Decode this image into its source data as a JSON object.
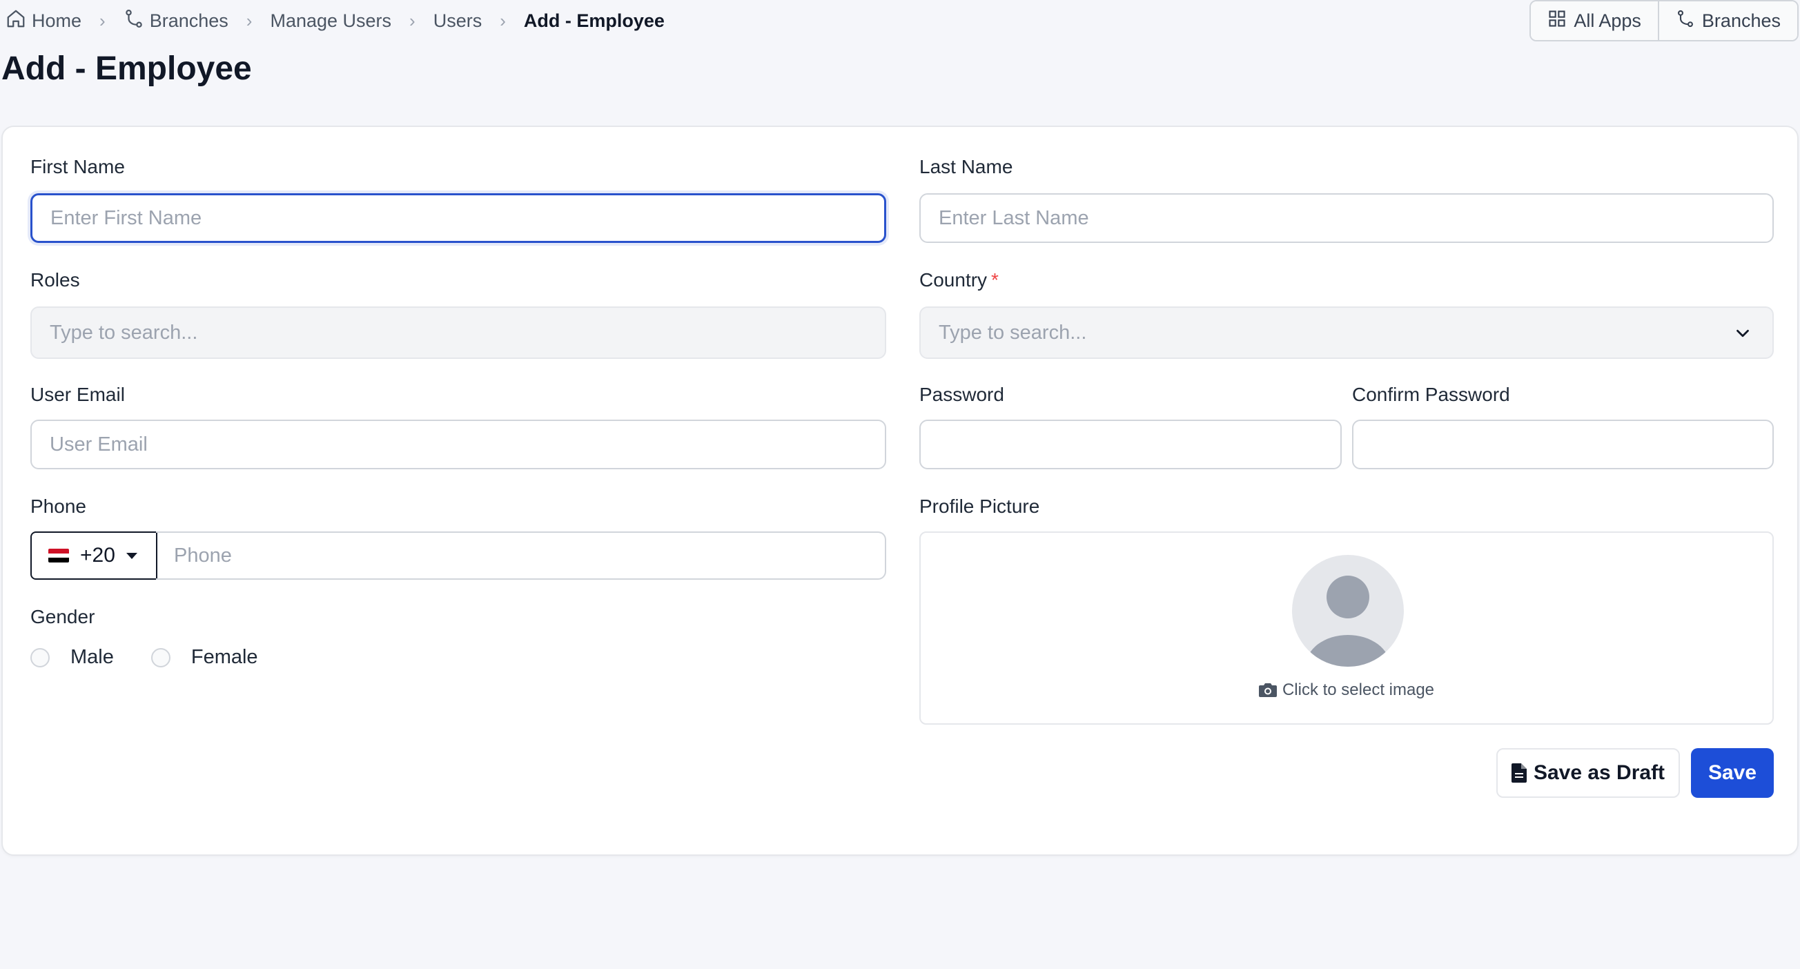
{
  "breadcrumb": {
    "items": [
      "Home",
      "Branches",
      "Manage Users",
      "Users"
    ],
    "current": "Add - Employee"
  },
  "top_actions": {
    "all_apps": "All Apps",
    "branches": "Branches"
  },
  "page_title": "Add - Employee",
  "form": {
    "first_name": {
      "label": "First Name",
      "placeholder": "Enter First Name"
    },
    "last_name": {
      "label": "Last Name",
      "placeholder": "Enter Last Name"
    },
    "roles": {
      "label": "Roles",
      "placeholder": "Type to search..."
    },
    "country": {
      "label": "Country",
      "required_mark": "*",
      "placeholder": "Type to search..."
    },
    "user_email": {
      "label": "User Email",
      "placeholder": "User Email"
    },
    "password": {
      "label": "Password"
    },
    "confirm_password": {
      "label": "Confirm Password"
    },
    "phone": {
      "label": "Phone",
      "country_code": "+20",
      "placeholder": "Phone"
    },
    "gender": {
      "label": "Gender",
      "options": [
        "Male",
        "Female"
      ]
    },
    "profile_picture": {
      "label": "Profile Picture",
      "hint": "Click to select image"
    }
  },
  "buttons": {
    "save_draft": "Save as Draft",
    "save": "Save"
  },
  "colors": {
    "primary": "#1d4ed8",
    "focus_border": "#2952cc",
    "required": "#ef4444",
    "background": "#f5f6fa"
  }
}
